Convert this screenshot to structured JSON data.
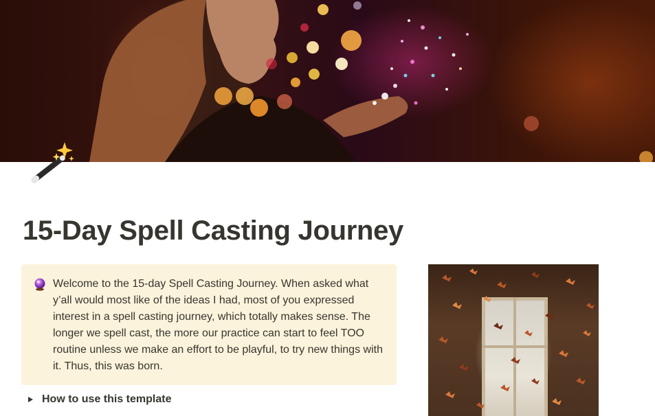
{
  "page": {
    "title": "15-Day Spell Casting Journey",
    "icon": "magic-wand-sparkles-icon",
    "cover": "woman-blowing-sparkles-cover-photo"
  },
  "callout": {
    "icon": "crystal-ball-icon",
    "text": "Welcome to the 15-day Spell Casting Journey. When asked what y’all would most like of the ideas I had, most of you expressed interest in a spell casting journey, which totally makes sense. The longer we spell cast, the more our practice can start to feel TOO routine unless we make an effort to be playful, to try new things with it. Thus, this was born.",
    "background": "#fbf3db"
  },
  "toggle": {
    "label": "How to use this template",
    "icon": "toggle-triangle-right-icon"
  },
  "side_image": {
    "subject": "butterflies-window-photo"
  }
}
